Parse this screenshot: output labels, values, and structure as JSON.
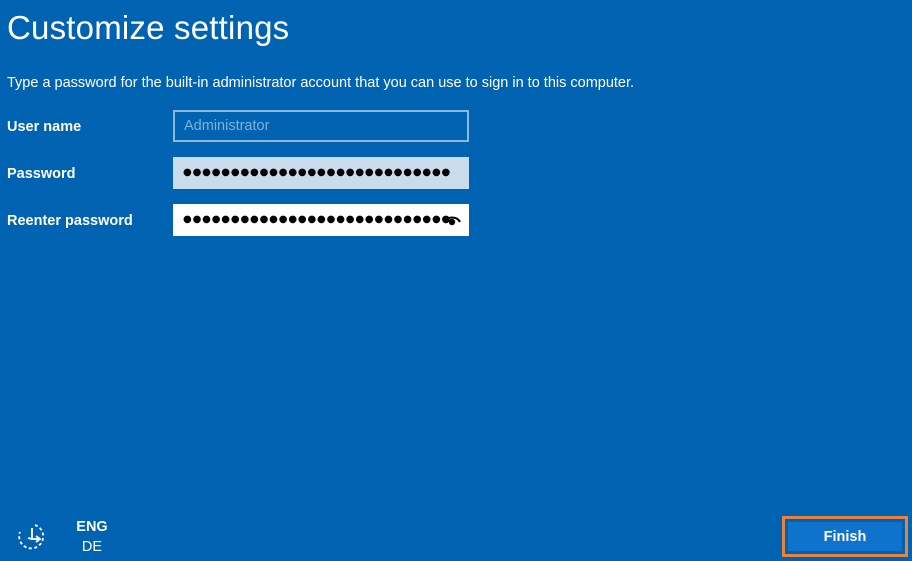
{
  "page": {
    "title": "Customize settings",
    "instructions": "Type a password for the built-in administrator account that you can use to sign in to this computer."
  },
  "fields": {
    "username": {
      "label": "User name",
      "placeholder": "Administrator",
      "value": ""
    },
    "password": {
      "label": "Password",
      "masked_value": "●●●●●●●●●●●●●●●●●●●●●●●●●●●●"
    },
    "reenter_password": {
      "label": "Reenter password",
      "masked_value": "●●●●●●●●●●●●●●●●●●●●●●●●●●●●",
      "reveal_icon": "eye-icon"
    }
  },
  "footer": {
    "accessibility_icon": "ease-of-access-icon",
    "language_primary": "ENG",
    "language_secondary": "DE",
    "finish_label": "Finish"
  },
  "colors": {
    "background": "#0063b1",
    "button": "#0d73cc",
    "highlight_border": "#e8823d",
    "password_box": "#c9dcec"
  }
}
